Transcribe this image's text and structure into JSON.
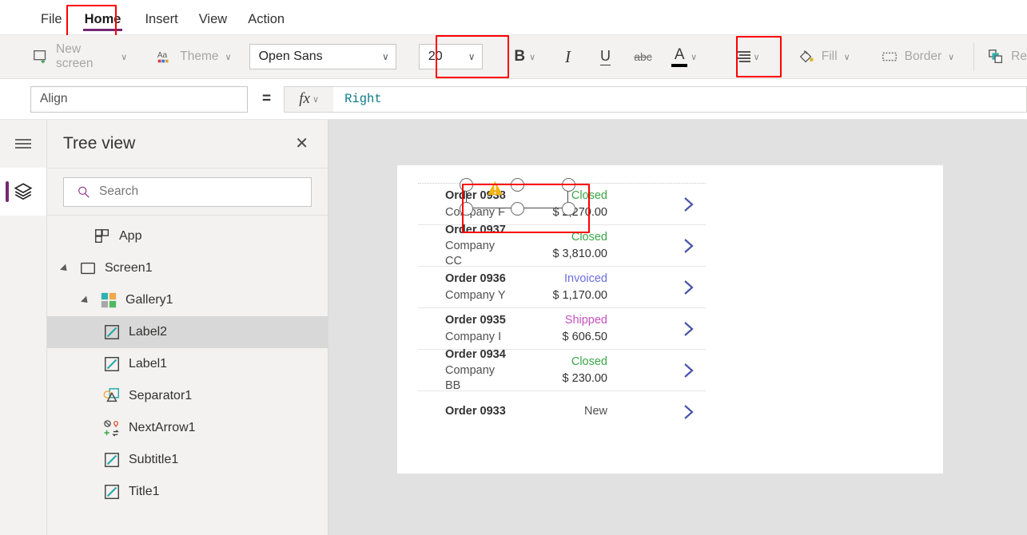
{
  "menu": {
    "tabs": [
      {
        "label": "File",
        "active": false
      },
      {
        "label": "Home",
        "active": true
      },
      {
        "label": "Insert",
        "active": false
      },
      {
        "label": "View",
        "active": false
      },
      {
        "label": "Action",
        "active": false
      }
    ]
  },
  "ribbon": {
    "new_screen_label": "New screen",
    "theme_label": "Theme",
    "font_family_value": "Open Sans",
    "font_size_value": "20",
    "bold_label": "B",
    "italic_label": "I",
    "underline_label": "U",
    "strikethrough_label": "abc",
    "font_color_label": "A",
    "align_icon_name": "align-right-icon",
    "fill_label": "Fill",
    "border_label": "Border",
    "reorder_label": "Re"
  },
  "formula_bar": {
    "property_value": "Align",
    "equals": "=",
    "fx_label": "fx",
    "formula_value": "Right"
  },
  "tree_view": {
    "title": "Tree view",
    "close_label": "✕",
    "search_placeholder": "Search",
    "search_value": "",
    "items": [
      {
        "label": "App",
        "depth": 0,
        "icon": "app-icon",
        "caret": false,
        "selected": false
      },
      {
        "label": "Screen1",
        "depth": 0,
        "icon": "screen-icon",
        "caret": true,
        "selected": false
      },
      {
        "label": "Gallery1",
        "depth": 1,
        "icon": "gallery-icon",
        "caret": true,
        "selected": false
      },
      {
        "label": "Label2",
        "depth": 2,
        "icon": "label-icon",
        "caret": false,
        "selected": true
      },
      {
        "label": "Label1",
        "depth": 2,
        "icon": "label-icon",
        "caret": false,
        "selected": false
      },
      {
        "label": "Separator1",
        "depth": 2,
        "icon": "shapes-icon",
        "caret": false,
        "selected": false
      },
      {
        "label": "NextArrow1",
        "depth": 2,
        "icon": "icons-icon",
        "caret": false,
        "selected": false
      },
      {
        "label": "Subtitle1",
        "depth": 2,
        "icon": "label-icon",
        "caret": false,
        "selected": false
      },
      {
        "label": "Title1",
        "depth": 2,
        "icon": "label-icon",
        "caret": false,
        "selected": false
      }
    ]
  },
  "canvas": {
    "gallery_rows": [
      {
        "title": "Order 0938",
        "company": "Company F",
        "status": "Closed",
        "status_color": "#3aa648",
        "amount": "$ 2,270.00",
        "selected": true
      },
      {
        "title": "Order 0937",
        "company": "Company CC",
        "status": "Closed",
        "status_color": "#3aa648",
        "amount": "$ 3,810.00",
        "selected": false
      },
      {
        "title": "Order 0936",
        "company": "Company Y",
        "status": "Invoiced",
        "status_color": "#6e6ee0",
        "amount": "$ 1,170.00",
        "selected": false
      },
      {
        "title": "Order 0935",
        "company": "Company I",
        "status": "Shipped",
        "status_color": "#c551c0",
        "amount": "$ 606.50",
        "selected": false
      },
      {
        "title": "Order 0934",
        "company": "Company BB",
        "status": "Closed",
        "status_color": "#3aa648",
        "amount": "$ 230.00",
        "selected": false
      },
      {
        "title": "Order 0933",
        "company": "",
        "status": "New",
        "status_color": "#4f4f4f",
        "amount": "",
        "selected": false
      }
    ]
  },
  "annotations": {
    "highlight_color": "#ff0000",
    "boxes": [
      "home-tab",
      "font-size-combo",
      "align-button",
      "selected-label"
    ]
  }
}
